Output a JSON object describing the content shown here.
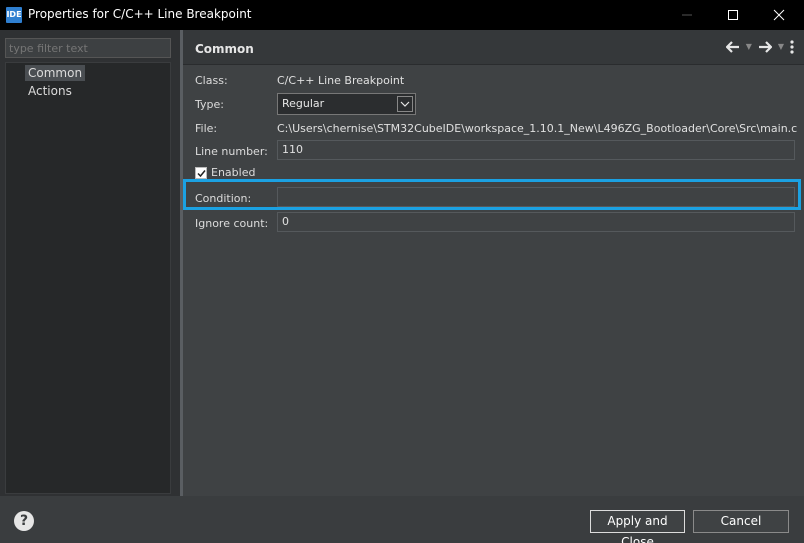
{
  "window": {
    "app_icon": "IDE",
    "title": "Properties for C/C++ Line Breakpoint",
    "minimize": "minimize-icon",
    "maximize": "maximize-icon",
    "close": "close-icon"
  },
  "filter": {
    "placeholder": "type filter text"
  },
  "tree": {
    "items": [
      {
        "label": "Common",
        "selected": true
      },
      {
        "label": "Actions",
        "selected": false
      }
    ]
  },
  "page": {
    "title": "Common",
    "nav": {
      "back": "arrow-left-icon",
      "forward": "arrow-right-icon",
      "menu": "kebab-menu-icon"
    }
  },
  "form": {
    "class_label": "Class:",
    "class_value": "C/C++ Line Breakpoint",
    "type_label": "Type:",
    "type_value": "Regular",
    "file_label": "File:",
    "file_value": "C:\\Users\\chernise\\STM32CubeIDE\\workspace_1.10.1_New\\L496ZG_Bootloader\\Core\\Src\\main.c",
    "line_label": "Line number:",
    "line_value": "110",
    "enabled_label": "Enabled",
    "enabled_checked": true,
    "condition_label": "Condition:",
    "condition_value": "",
    "ignore_label": "Ignore count:",
    "ignore_value": "0"
  },
  "footer": {
    "help": "?",
    "apply_label": "Apply and Close",
    "cancel_label": "Cancel"
  },
  "colors": {
    "highlight": "#1ba1e2"
  }
}
